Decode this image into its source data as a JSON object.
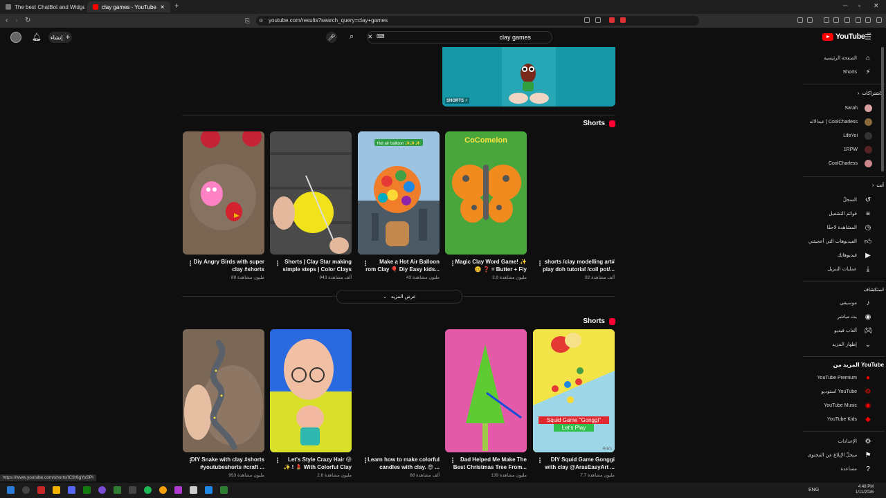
{
  "browser": {
    "tabs": [
      {
        "label": "The best ChatBot and Widgets fr",
        "active": false
      },
      {
        "label": "clay games - YouTube",
        "active": true
      }
    ],
    "new_tab": "+",
    "url": "youtube.com/results?search_query=clay+games",
    "status_url": "https://www.youtube.com/shorts/IC9r6gYoSPI"
  },
  "youtube": {
    "logo_text": "YouTube",
    "logo_sup": "SA",
    "search_value": "clay games",
    "create_label": "إنشاء"
  },
  "top_card": {
    "badge": "SHORTS"
  },
  "shelf1": {
    "label": "Shorts",
    "items": [
      {
        "title_l1": "Diy Angry Birds with super",
        "title_l2": "clay #shorts",
        "views": "88 مليون مشاهدة"
      },
      {
        "title_l1": "Shorts | Clay Star making",
        "title_l2": "simple steps | Color Clays",
        "views": "943 ألف مشاهدة"
      },
      {
        "title_l1": "Make a Hot Air Balloon",
        "title_l2": "rom Clay 🎈 Diy Easy kids...",
        "views": "43 مليون مشاهدة"
      },
      {
        "title_l1": "Magic Clay Word Game! ✨",
        "title_l2": "🥴 ❓ = Butter + Fly",
        "views": "3.9 مليون مشاهدة"
      },
      {
        "title_l1": "shorts /clay modelling art#",
        "title_l2": "play doh tutorial /coil pot/...",
        "views": "82 ألف مشاهدة"
      }
    ],
    "thumb_text": {
      "third_banner": "Hot air balloon ✨✨✨",
      "fourth_brand": "CoComelon"
    },
    "more_label": "عرض المزيد"
  },
  "shelf2": {
    "label": "Shorts",
    "items": [
      {
        "title_l1": "DIY Snake with clay #shorts",
        "title_l2": "#youtubeshorts #craft ...",
        "views": "953 مليون مشاهدة"
      },
      {
        "title_l1": "Let's Style Crazy Hair 😜",
        "title_l2": "✨ ! 💄 With Colorful Clay",
        "views": "2.8 مليون مشاهدة"
      },
      {
        "title_l1": "Learn how to make colorful",
        "title_l2": "candles with clay. 😍 ...",
        "views": "88 ألف مشاهدة"
      },
      {
        "title_l1": "Dad Helped Me Make The",
        "title_l2": "Best Christmas Tree From...",
        "views": "139 مليون مشاهدة"
      },
      {
        "title_l1": "DIY Squid Game Gonggi",
        "title_l2": "with clay @ArasEasyArt ...",
        "views": "7.7 مليون مشاهدة"
      }
    ],
    "squid_l1": "Squid Game \"Gonggi\"",
    "squid_l2": "Let's Play",
    "watermark": "Ara's"
  },
  "sidebar": {
    "home": "الصفحة الرئيسية",
    "shorts": "Shorts",
    "subs_head": "الاشتراكات",
    "subs": [
      {
        "name": "Sarah",
        "color": "#d9a0a0"
      },
      {
        "name": "عبدالاله | CoolCharless",
        "color": "#8a6a3a"
      },
      {
        "name": "LifeYoi",
        "color": "#333333"
      },
      {
        "name": "1RPW",
        "color": "#552222"
      },
      {
        "name": "CoolCharless",
        "color": "#cc8888"
      }
    ],
    "you_head": "أنت",
    "you_items": [
      "السجلّ",
      "قوائم التشغيل",
      "المشاهدة لاحقًا",
      "الفيديوهات التي أعجبتني",
      "فيديوهاتك",
      "عمليات التنزيل"
    ],
    "explore_head": "استكشاف",
    "explore_items": [
      "موسيقى",
      "بث مباشر",
      "ألعاب فيديو",
      "إظهار المزيد"
    ],
    "more_head": "المزيد من YouTube",
    "more_items": [
      "YouTube Premium",
      "استوديو YouTube",
      "YouTube Music",
      "YouTube Kids"
    ],
    "settings_items": [
      "الإعدادات",
      "سجلّ الإبلاغ عن المحتوى",
      "مساعدة"
    ]
  },
  "taskbar": {
    "lang": "ENG",
    "time": "4:48 PM",
    "date": "1/11/2026"
  },
  "colors": {
    "accent": "#ff0000",
    "bg": "#0f0f0f"
  }
}
